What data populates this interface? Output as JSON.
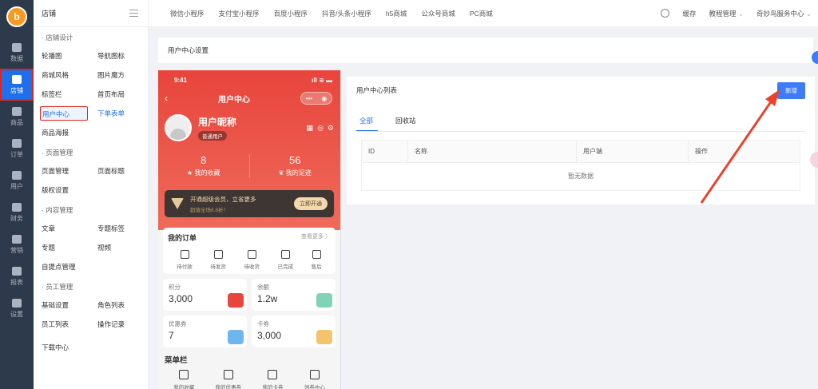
{
  "rail": {
    "logo": "b",
    "items": [
      {
        "label": "数据",
        "icon": "home-icon"
      },
      {
        "label": "店铺",
        "icon": "store-icon",
        "active": true
      },
      {
        "label": "商品",
        "icon": "bag-icon"
      },
      {
        "label": "订单",
        "icon": "order-icon"
      },
      {
        "label": "用户",
        "icon": "user-icon"
      },
      {
        "label": "财务",
        "icon": "wallet-icon"
      },
      {
        "label": "营销",
        "icon": "grid-icon"
      },
      {
        "label": "报表",
        "icon": "chart-icon"
      },
      {
        "label": "设置",
        "icon": "gear-icon"
      }
    ]
  },
  "submenu": {
    "title": "店铺",
    "groups": [
      {
        "title": "· 店铺设计",
        "items": [
          "轮播图",
          "导航图标",
          "商城风格",
          "图片魔方",
          "标签栏",
          "首页布局",
          "用户中心",
          "下单表单",
          "商品海报"
        ]
      },
      {
        "title": "· 页面管理",
        "items": [
          "页面管理",
          "页面标题",
          "版权设置"
        ]
      },
      {
        "title": "· 内容管理",
        "items": [
          "文章",
          "专题标签",
          "专题",
          "视频",
          "自提点管理"
        ]
      },
      {
        "title": "· 员工管理",
        "items": [
          "基础设置",
          "角色列表",
          "员工列表",
          "操作记录"
        ]
      }
    ],
    "footer": "下载中心"
  },
  "topbar": {
    "tabs": [
      "微信小程序",
      "支付宝小程序",
      "百度小程序",
      "抖音/头条小程序",
      "h5商城",
      "公众号商城",
      "PC商城"
    ],
    "cache": "缓存",
    "tutorial": "教程管理",
    "account": "奇妙鸟服务中心"
  },
  "page_title": "用户中心设置",
  "phone": {
    "time": "9:41",
    "title": "用户中心",
    "nickname": "用户昵称",
    "level": "普通用户",
    "stats": [
      {
        "num": "8",
        "label": "我的收藏"
      },
      {
        "num": "56",
        "label": "我的足迹"
      }
    ],
    "vip_line1": "开通超级会员，立省更多",
    "vip_line2": "超值全场8.8折！",
    "vip_button": "立即开通",
    "orders_title": "我的订单",
    "orders_more": "查看更多 〉",
    "orders": [
      "待付款",
      "待发货",
      "待收货",
      "已完成",
      "售后"
    ],
    "cards": [
      {
        "label": "积分",
        "value": "3,000",
        "color": "#e8453c"
      },
      {
        "label": "余额",
        "value": "1.2w",
        "color": "#7fd3b6"
      },
      {
        "label": "优惠券",
        "value": "7",
        "color": "#6fb5ee"
      },
      {
        "label": "卡券",
        "value": "3,000",
        "color": "#f3c46b"
      }
    ],
    "menu_title": "菜单栏",
    "menu_items": [
      "我的收藏",
      "我的优惠券",
      "我的卡券",
      "领券中心"
    ]
  },
  "list": {
    "title": "用户中心列表",
    "add_button": "新增",
    "tabs": [
      "全部",
      "回收站"
    ],
    "columns": [
      "ID",
      "名称",
      "用户端",
      "操作"
    ],
    "empty": "暂无数据"
  }
}
